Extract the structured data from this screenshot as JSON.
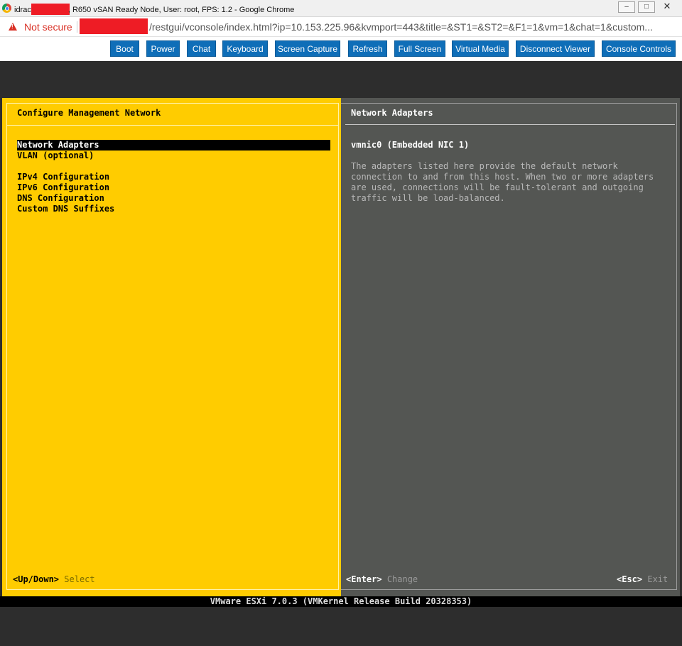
{
  "window": {
    "title_prefix": "idrac",
    "title_suffix": "R650 vSAN Ready Node, User: root, FPS: 1.2 - Google Chrome",
    "minimize": "‒",
    "maximize": "□",
    "close": "✕"
  },
  "address": {
    "security_label": "Not secure",
    "url": "/restgui/vconsole/index.html?ip=10.153.225.96&kvmport=443&title=&ST1=&ST2=&F1=1&vm=1&chat=1&custom..."
  },
  "toolbar": {
    "boot": "Boot",
    "power": "Power",
    "chat": "Chat",
    "keyboard": "Keyboard",
    "screen_capture": "Screen Capture",
    "refresh": "Refresh",
    "full_screen": "Full Screen",
    "virtual_media": "Virtual Media",
    "disconnect_viewer": "Disconnect Viewer",
    "console_controls": "Console Controls"
  },
  "esxi": {
    "left_title": "Configure Management Network",
    "menu": [
      "Network Adapters",
      "VLAN (optional)",
      "",
      "IPv4 Configuration",
      "IPv6 Configuration",
      "DNS Configuration",
      "Custom DNS Suffixes"
    ],
    "selected_index": 0,
    "right_title": "Network Adapters",
    "nic": "vmnic0 (Embedded NIC 1)",
    "description": [
      "The adapters listed here provide the default network",
      "connection to and from this host. When two or more adapters",
      "are used, connections will be fault-tolerant and outgoing",
      "traffic will be load-balanced."
    ],
    "hints": {
      "updown_key": "<Up/Down>",
      "updown_action": "Select",
      "enter_key": "<Enter>",
      "enter_action": "Change",
      "esc_key": "<Esc>",
      "esc_action": "Exit"
    },
    "status": "VMware ESXi 7.0.3 (VMKernel Release Build 20328353)"
  },
  "colors": {
    "left_panel": "#ffcc00",
    "right_panel": "#545653",
    "toolbar_button": "#0f6eb8",
    "warning": "#d93025"
  }
}
